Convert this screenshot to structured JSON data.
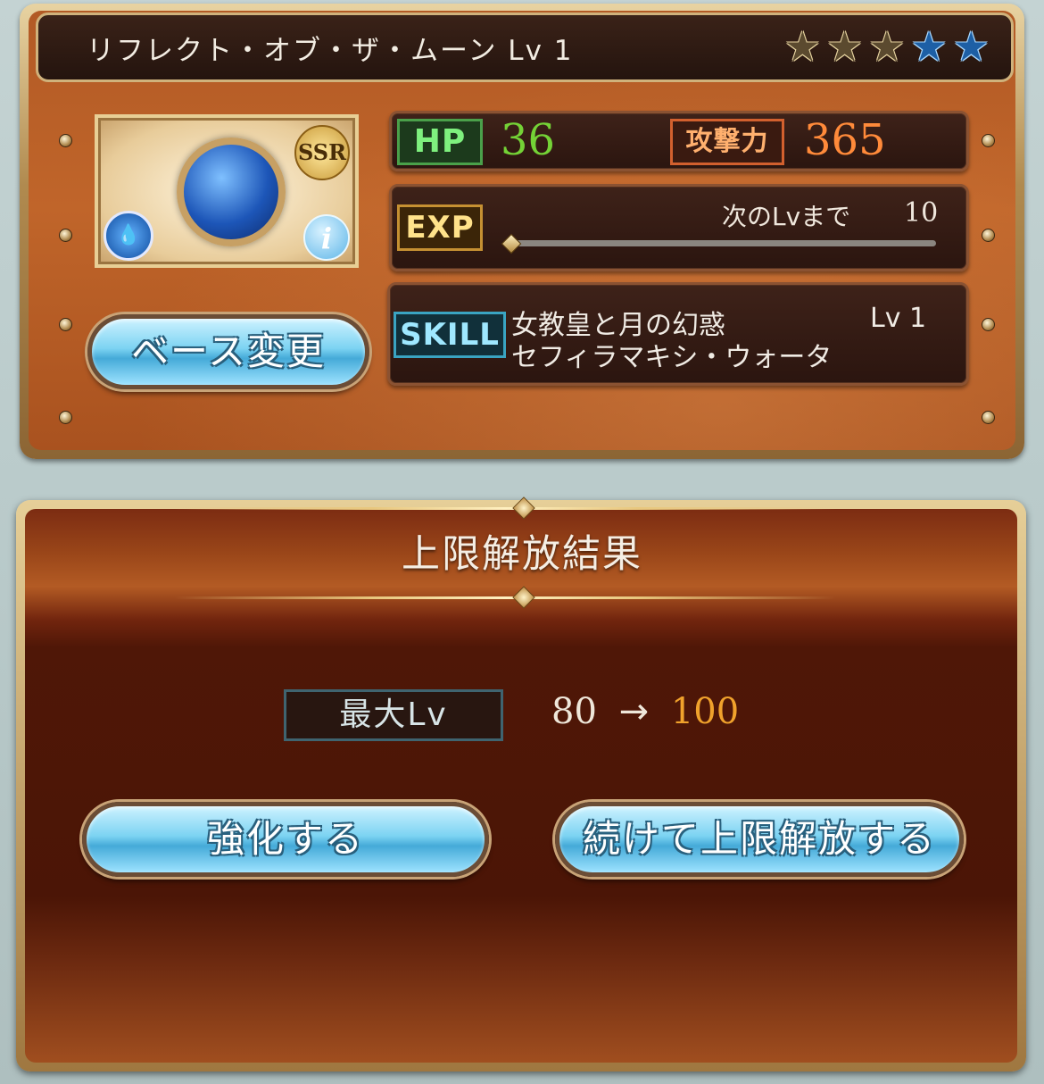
{
  "summon": {
    "name_level": "リフレクト・オブ・ザ・ムーン Lv 1",
    "rarity": "SSR",
    "element": "water",
    "uncap_stars": {
      "filled": 3,
      "total": 5
    },
    "hp_label": "HP",
    "hp": "36",
    "atk_label": "攻撃力",
    "atk": "365",
    "exp_label": "EXP",
    "next_lv_label": "次のLvまで",
    "next_lv_value": "10",
    "exp_progress": 0,
    "skill_label": "SKILL",
    "skill_name": "女教皇と月の幻惑",
    "skill_level": "Lv 1",
    "skill_sub": "セフィラマキシ・ウォータ",
    "base_change_button": "ベース変更"
  },
  "result": {
    "title": "上限解放結果",
    "max_lv_label": "最大Lv",
    "max_lv_from": "80",
    "arrow": "→",
    "max_lv_to": "100",
    "enhance_button": "強化する",
    "continue_button": "続けて上限解放する"
  },
  "colors": {
    "hp_value": "#74d236",
    "atk_value": "#ff8a3a",
    "max_lv_to": "#f0a22c",
    "button_blue": "#7cd3f2"
  }
}
